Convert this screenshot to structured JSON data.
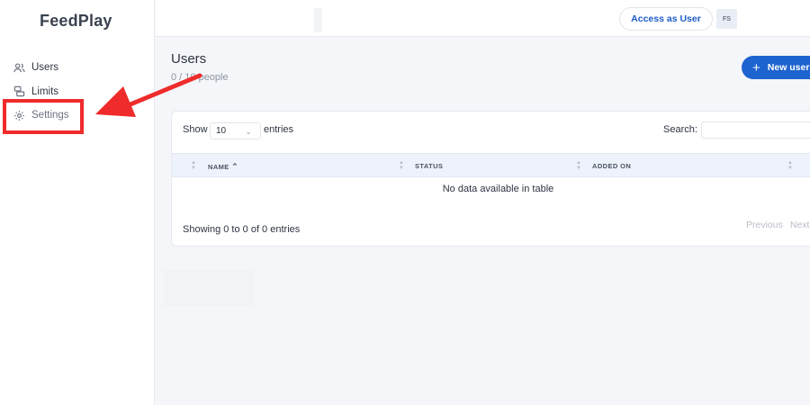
{
  "app": {
    "brand": "FeedPlay"
  },
  "sidebar": {
    "items": [
      {
        "label": "Users",
        "icon": "users-icon"
      },
      {
        "label": "Limits",
        "icon": "limits-icon"
      },
      {
        "label": "Settings",
        "icon": "gear-icon"
      }
    ]
  },
  "topbar": {
    "access_label": "Access as User",
    "avatar_initials": "FS"
  },
  "page": {
    "title": "Users",
    "subtitle": "0 / 10 people",
    "new_button": "New user"
  },
  "table": {
    "show_label": "Show",
    "entries_value": "10",
    "entries_label": "entries",
    "search_label": "Search:",
    "search_value": "",
    "columns": [
      "NAME",
      "STATUS",
      "ADDED ON"
    ],
    "empty_message": "No data available in table",
    "info": "Showing 0 to 0 of 0 entries",
    "pager": {
      "previous": "Previous",
      "next": "Next"
    }
  },
  "annotation": {
    "highlight_color": "#ef2b2b"
  },
  "colors": {
    "accent": "#1e64d0",
    "sidebar_bg": "#ffffff",
    "page_bg": "#f4f6f9"
  }
}
